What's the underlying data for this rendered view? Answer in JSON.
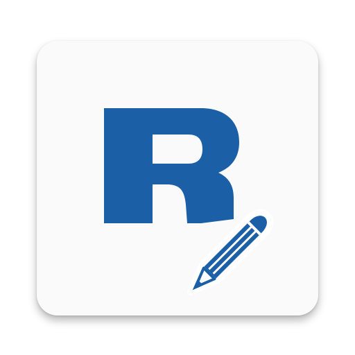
{
  "app_icon": {
    "logo": {
      "letter": "R",
      "icon": "pencil-icon"
    },
    "colors": {
      "brand": "#1b5fa6",
      "tile": "#fafafa",
      "background": "#ffffff"
    }
  }
}
